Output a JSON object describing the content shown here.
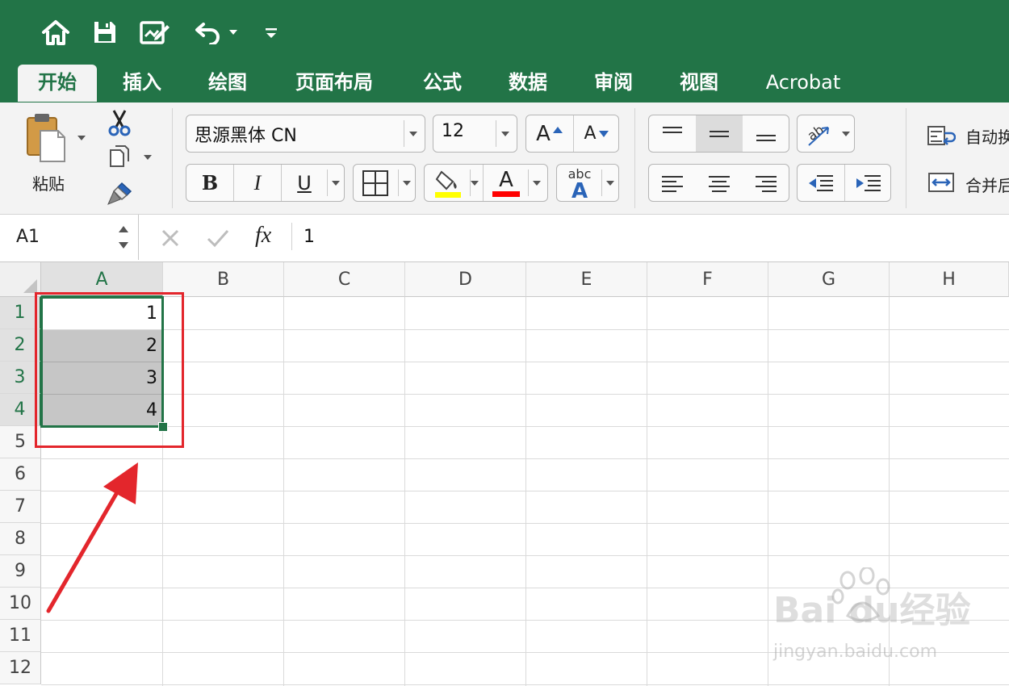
{
  "ribbon_tabs": [
    "开始",
    "插入",
    "绘图",
    "页面布局",
    "公式",
    "数据",
    "审阅",
    "视图",
    "Acrobat"
  ],
  "ribbon": {
    "paste_label": "粘贴",
    "font_name": "思源黑体 CN",
    "font_size": "12",
    "bold": "B",
    "italic": "I",
    "underline": "U",
    "grow_font": "A",
    "shrink_font": "A",
    "font_color_letter": "A",
    "fill_color": "#ffff00",
    "font_color": "#ff0000",
    "abc_text": "abc",
    "abc_letter": "A",
    "wrap_text_label": "自动换",
    "merge_label": "合并后"
  },
  "formula_bar": {
    "name_box": "A1",
    "fx": "fx",
    "value": "1"
  },
  "sheet": {
    "columns": [
      "A",
      "B",
      "C",
      "D",
      "E",
      "F",
      "G",
      "H"
    ],
    "rows": [
      "1",
      "2",
      "3",
      "4",
      "5",
      "6",
      "7",
      "8",
      "9",
      "10",
      "11",
      "12"
    ],
    "a_column_values": [
      "1",
      "2",
      "3",
      "4"
    ],
    "active_row_numbers": [
      "1",
      "2",
      "3",
      "4"
    ]
  },
  "watermark": {
    "brand": "Bai  du经验",
    "url": "jingyan.baidu.com"
  },
  "colors": {
    "excel_green": "#227447",
    "selection_gray": "#c6c6c6",
    "annotation_red": "#e3262c"
  }
}
